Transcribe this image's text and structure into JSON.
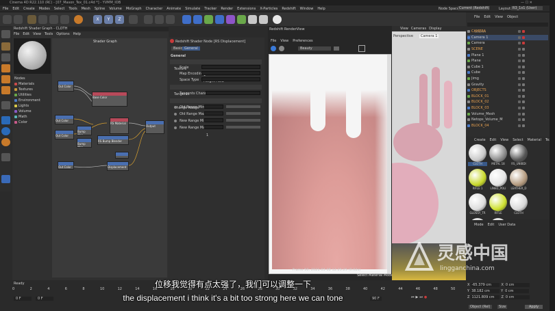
{
  "window": {
    "title": "Cinema 4D R22.110 (RC) - [07_Mason_Tex_01.c4d *] - YVMM_IOB"
  },
  "menu": [
    "File",
    "Edit",
    "Create",
    "Modes",
    "Select",
    "Tools",
    "Mesh",
    "Spline",
    "Volume",
    "MoGraph",
    "Character",
    "Animate",
    "Simulate",
    "Tracker",
    "Render",
    "Extensions",
    "X-Particles",
    "Redshift",
    "Window",
    "Help"
  ],
  "node_space": {
    "label": "Node Space:",
    "value": "Current (Redshift)"
  },
  "layout": {
    "label": "Layout:",
    "value": "R3_1x1 (User)"
  },
  "shader_graph": {
    "window_title": "Redshift Shader Graph - CLOTH",
    "menu": [
      "File",
      "Edit",
      "View",
      "Tools",
      "Options",
      "Help"
    ],
    "canvas_title": "Shader Graph",
    "nodes_header": "Nodes",
    "node_categories": [
      "Materials",
      "Textures",
      "Utilities",
      "Environment",
      "Lights",
      "Volume",
      "Math",
      "Color"
    ],
    "graph_nodes": [
      {
        "title": "Texture",
        "port": "Out Color"
      },
      {
        "title": "RS Material",
        "port": "Base Color"
      },
      {
        "title": "Bump Map",
        "port": "Out"
      },
      {
        "title": "RS Bump Blender",
        "port": "Base Input"
      },
      {
        "title": "Output",
        "port": "Surface"
      },
      {
        "title": "Displacement",
        "port": "Out"
      }
    ]
  },
  "properties": {
    "title": "Redshift Shader Node [RS Displacement]",
    "tabs": [
      "Basic",
      "General"
    ],
    "general_header": "General",
    "texture_header": "Texture",
    "rows": [
      {
        "label": "Scale",
        "value": "1"
      },
      {
        "label": "Map Encoding",
        "value": "Height Field"
      },
      {
        "label": "Space Type",
        "value": "Object"
      }
    ],
    "tangents_header": "Tangents",
    "tangents_channel": "Tangents Channel",
    "change_range_header": "Change Range",
    "range_rows": [
      {
        "label": "Old Range Min",
        "value": "0"
      },
      {
        "label": "Old Range Max",
        "value": "1"
      },
      {
        "label": "New Range Min",
        "value": "0"
      },
      {
        "label": "New Range Max",
        "value": "1"
      }
    ]
  },
  "renderview": {
    "title": "Redshift RenderView",
    "menu": [
      "File",
      "View",
      "Preferences"
    ],
    "aov": "Beauty",
    "frame_info": "Frame  50:  2021-03-08  12:25:25  (0.02s)",
    "status": "Select Material Mode"
  },
  "viewport": {
    "menu": [
      "View",
      "Cameras",
      "Display"
    ],
    "view_name": "Perspective",
    "camera": "Camera 1"
  },
  "object_manager": {
    "menu": [
      "File",
      "Edit",
      "View",
      "Object"
    ],
    "search_placeholder": "Search",
    "objects": [
      "CAMERA",
      "Camera 1",
      "Camera",
      "SCENE",
      "Plane 1",
      "Plane",
      "Cube 1",
      "Cube",
      "Jimg",
      "Gravity",
      "OBJECTS",
      "BLOCK_01",
      "BLOCK_02",
      "BLOCK_03",
      "Volume_Mesh",
      "Netops_Volume_M",
      "BLOCK_04"
    ]
  },
  "material_manager": {
    "menu": [
      "Create",
      "Edit",
      "View",
      "Select",
      "Material",
      "Texture"
    ],
    "materials": [
      {
        "name": "CLOTH",
        "color": "#c9c9c9"
      },
      {
        "name": "METAL 18",
        "color": "#8a8a8a"
      },
      {
        "name": "RS_UNIBDI",
        "color": "#555555"
      },
      {
        "name": "RIFLE 1",
        "color": "#c8d82a"
      },
      {
        "name": "LINED_POLI",
        "color": "#e4e4e4"
      },
      {
        "name": "LEATHER_D",
        "color": "#b49a7e"
      },
      {
        "name": "GLOSSY_TR",
        "color": "#dcdcdc"
      },
      {
        "name": "RIFLE",
        "color": "#cde02e"
      },
      {
        "name": "CLOTH",
        "color": "#d8d8d8"
      },
      {
        "name": "RS Material",
        "color": "#cfcfcf"
      },
      {
        "name": "RS Material",
        "color": "#d5d5d5"
      }
    ]
  },
  "attribute_manager": {
    "menu": [
      "Mode",
      "Edit",
      "User Data"
    ],
    "coords": [
      {
        "axis": "X",
        "value": "-65.379 cm",
        "axis2": "X",
        "value2": "0 cm"
      },
      {
        "axis": "Y",
        "value": "38.182 cm",
        "axis2": "Y",
        "value2": "0 cm"
      },
      {
        "axis": "Z",
        "value": "1121.809 cm",
        "axis2": "Z",
        "value2": "0 cm"
      }
    ],
    "mode": "Object (Rel)",
    "size_label": "Size",
    "apply": "Apply"
  },
  "timeline": {
    "status": "Ready",
    "ticks": [
      "0",
      "2",
      "4",
      "6",
      "8",
      "10",
      "12",
      "14",
      "16",
      "18",
      "20",
      "22",
      "24",
      "26",
      "28",
      "30",
      "32",
      "34",
      "36",
      "38",
      "40",
      "42",
      "44",
      "46",
      "48",
      "50"
    ],
    "start": "0 F",
    "current": "0 F",
    "end_label": "90 F"
  },
  "subtitle": {
    "zh": "位移我觉得有点太强了，我们可以调整一下",
    "en": "the displacement i think it's a bit too strong here we can tone"
  },
  "watermark": {
    "zh": "灵感中国",
    "url": "lingganchina.com"
  }
}
